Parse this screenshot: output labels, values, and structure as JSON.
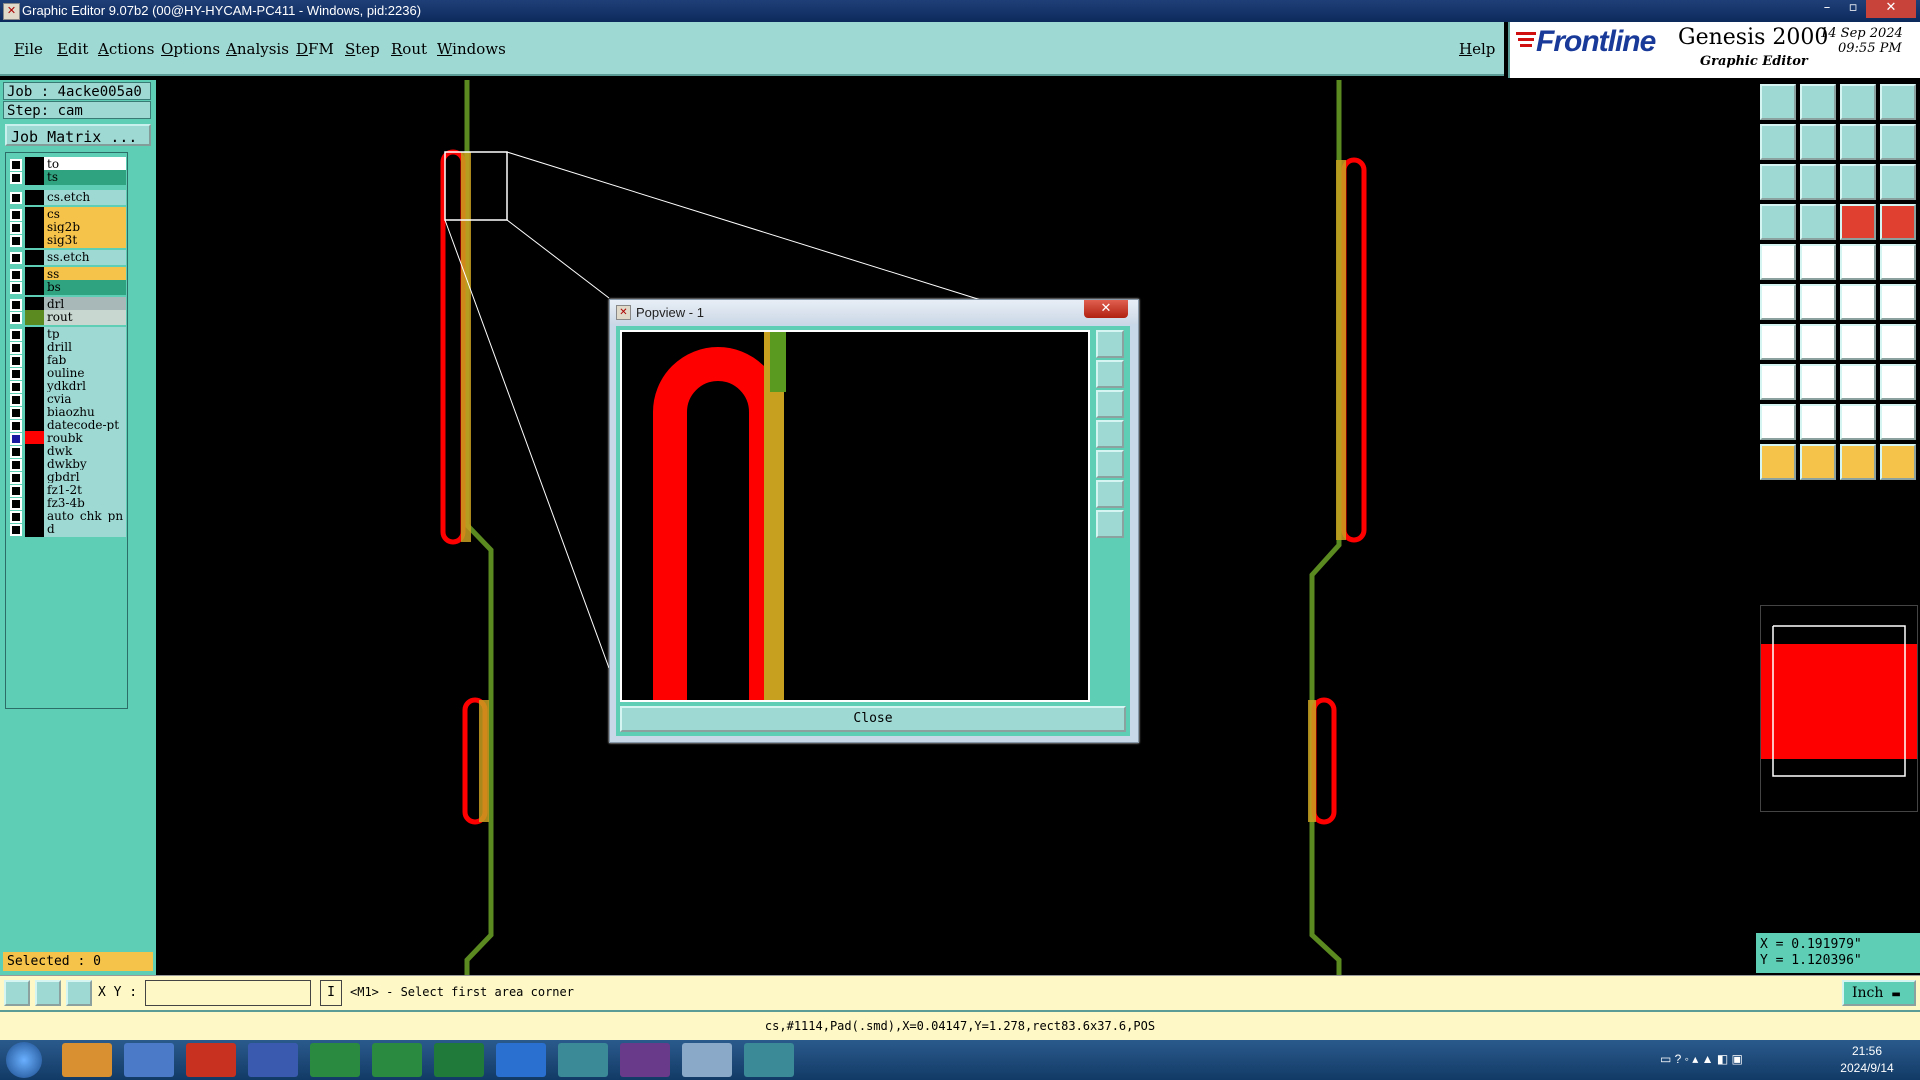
{
  "window": {
    "title": "Graphic Editor 9.07b2 (00@HY-HYCAM-PC411 - Windows, pid:2236)",
    "min": "–",
    "max": "▫",
    "close": "✕"
  },
  "menu": {
    "items": [
      "File",
      "Edit",
      "Actions",
      "Options",
      "Analysis",
      "DFM",
      "Step",
      "Rout",
      "Windows"
    ],
    "help": "Help"
  },
  "logo": {
    "brand": "Frontline",
    "product": "Genesis 2000",
    "subtitle": "Graphic Editor",
    "date": "14 Sep 2024",
    "time": "09:55 PM"
  },
  "job": {
    "job_line": "Job : 4acke005a0",
    "step_line": "Step: cam",
    "matrix_button": "Job Matrix ..."
  },
  "layers": [
    {
      "name": "to",
      "color": "#ffffff"
    },
    {
      "name": "ts",
      "color": "#2fa37f"
    },
    {
      "name": "cs.etch",
      "color": "#9fd9d4"
    },
    {
      "name": "cs",
      "color": "#f5c24a"
    },
    {
      "name": "sig2b",
      "color": "#f5c24a"
    },
    {
      "name": "sig3t",
      "color": "#f5c24a"
    },
    {
      "name": "ss.etch",
      "color": "#9fd9d4"
    },
    {
      "name": "ss",
      "color": "#f5c24a"
    },
    {
      "name": "bs",
      "color": "#2fa37f"
    },
    {
      "name": "drl",
      "color": "#a8b8b8"
    },
    {
      "name": "rout",
      "color": "#c8d8d0"
    },
    {
      "name": "tp",
      "color": "#9fd9d4"
    },
    {
      "name": "drill",
      "color": "#9fd9d4"
    },
    {
      "name": "fab",
      "color": "#9fd9d4"
    },
    {
      "name": "ouline",
      "color": "#9fd9d4"
    },
    {
      "name": "ydkdrl",
      "color": "#9fd9d4"
    },
    {
      "name": "cvia",
      "color": "#9fd9d4"
    },
    {
      "name": "biaozhu",
      "color": "#9fd9d4"
    },
    {
      "name": "datecode-pt",
      "color": "#9fd9d4"
    },
    {
      "name": "roubk",
      "color": "#9fd9d4"
    },
    {
      "name": "dwk",
      "color": "#9fd9d4"
    },
    {
      "name": "dwkby",
      "color": "#9fd9d4"
    },
    {
      "name": "gbdrl",
      "color": "#9fd9d4"
    },
    {
      "name": "fz1-2t",
      "color": "#9fd9d4"
    },
    {
      "name": "fz3-4b",
      "color": "#9fd9d4"
    },
    {
      "name": "auto_chk_pn",
      "color": "#9fd9d4"
    },
    {
      "name": "d",
      "color": "#9fd9d4"
    }
  ],
  "selected_text": "Selected : 0",
  "popview": {
    "title": "Popview - 1",
    "close_label": "Close"
  },
  "coords": {
    "x": "X = 0.191979\"",
    "y": "Y = 1.120396\""
  },
  "command": {
    "xy_label": "X Y :",
    "xy_value": "",
    "prompt": "<M1> - Select first area corner",
    "units": "Inch"
  },
  "status": "cs,#1114,Pad(.smd),X=0.04147,Y=1.278,rect83.6x37.6,POS",
  "taskbar": {
    "time": "21:56",
    "date": "2024/9/14"
  },
  "colors": {
    "accent": "#9fd9d4",
    "panel": "#5ecfb5",
    "layer_red": "#ff0000",
    "layer_gold": "#c8a020",
    "layer_green": "#5a8a20"
  }
}
